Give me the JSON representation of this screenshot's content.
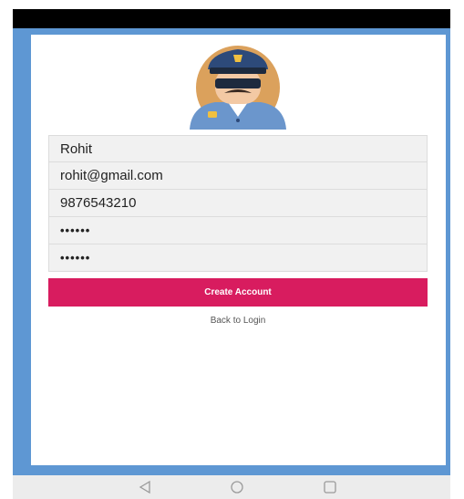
{
  "form": {
    "name_value": "Rohit",
    "email_value": "rohit@gmail.com",
    "phone_value": "9876543210",
    "password_value": "••••••",
    "confirm_password_value": "••••••"
  },
  "actions": {
    "create_account_label": "Create Account",
    "back_to_login_label": "Back to Login"
  },
  "avatar": {
    "icon": "police-officer-icon",
    "background_color": "#dba15c"
  },
  "colors": {
    "accent": "#d81c5f",
    "frame": "#5e97d3",
    "field_bg": "#f1f1f1"
  },
  "nav": {
    "icons": [
      "back-icon",
      "home-icon",
      "recents-icon"
    ]
  }
}
